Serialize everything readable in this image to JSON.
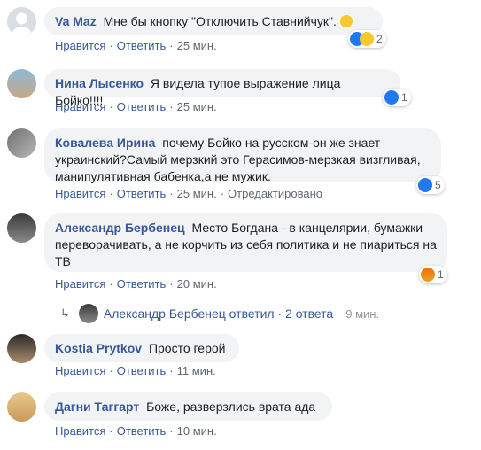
{
  "comments": [
    {
      "name": "Va Maz",
      "text": "Мне бы кнопку \"Отключить Ставнийчук\".",
      "like": "Нравится",
      "reply": "Ответить",
      "time": "25 мин.",
      "reaction_count": "2",
      "reaction_icons": [
        "like-icon",
        "haha-icon"
      ]
    },
    {
      "name": "Нина Лысенко",
      "text": "Я видела тупое выражение лица Бойко!!!!",
      "like": "Нравится",
      "reply": "Ответить",
      "time": "25 мин.",
      "reaction_count": "1",
      "reaction_icons": [
        "like-icon"
      ]
    },
    {
      "name": "Ковалева Ирина",
      "text": "почему Бойко на русском-он же знает украинский?Самый мерзкий это Герасимов-мерзкая визгливая, манипулятивная бабенка,а не мужик.",
      "like": "Нравится",
      "reply": "Ответить",
      "time": "25 мин.",
      "edited": "Отредактировано",
      "reaction_count": "5",
      "reaction_icons": [
        "like-icon"
      ]
    },
    {
      "name": "Александр Бербенец",
      "text": "Место Богдана - в канцелярии, бумажки переворачивать, а не корчить из себя политика и не пиариться на ТВ",
      "like": "Нравится",
      "reply": "Ответить",
      "time": "20 мин.",
      "reaction_count": "1",
      "reaction_icons": [
        "angry-icon"
      ]
    },
    {
      "name": "Kostia Prytkov",
      "text": "Просто герой",
      "like": "Нравится",
      "reply": "Ответить",
      "time": "11 мин."
    },
    {
      "name": "Дагни Таггарт",
      "text": "Боже, разверзлись врата ада",
      "like": "Нравится",
      "reply": "Ответить",
      "time": "10 мин."
    }
  ],
  "replies_summary": {
    "text": "Александр Бербенец ответил · 2 ответа",
    "time": "9 мин."
  },
  "colors": {
    "link": "#385898",
    "meta": "#606770",
    "bubble": "#f2f3f5",
    "like": "#2078f4"
  }
}
